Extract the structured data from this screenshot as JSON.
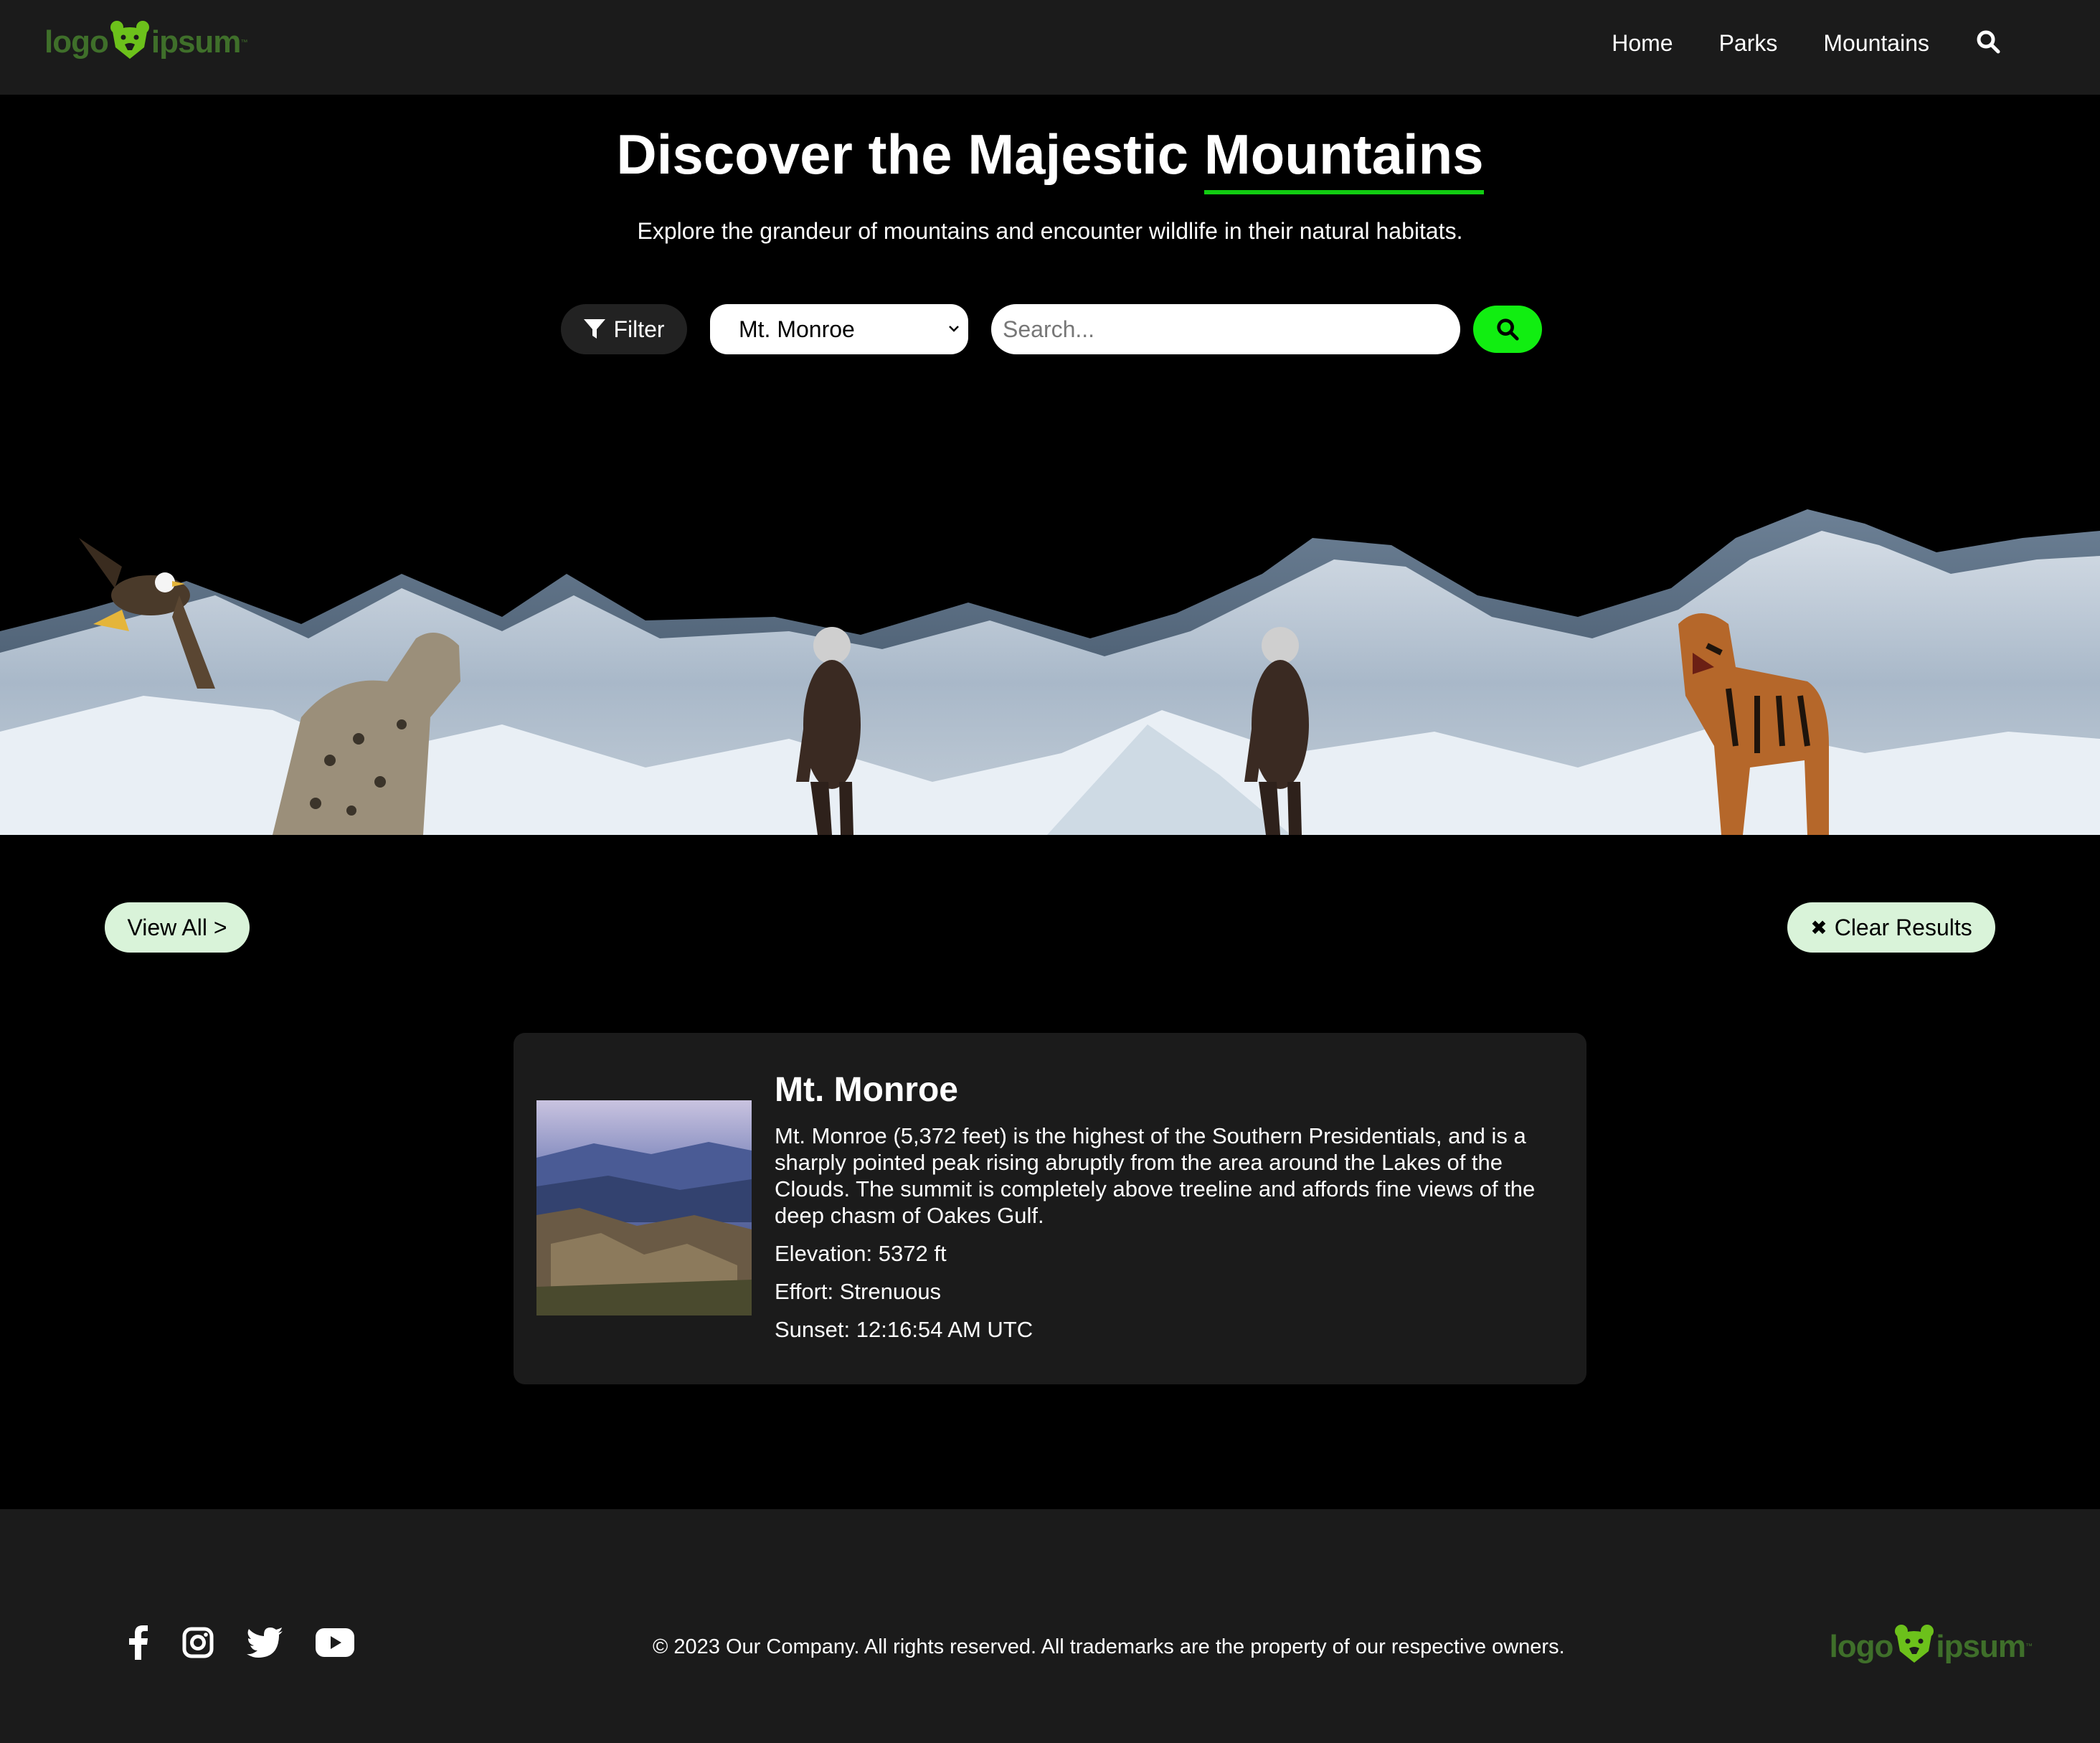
{
  "brand": {
    "logo_left": "logo",
    "logo_right": "ipsum",
    "logo_tm": "™",
    "color": "#3f6f2a",
    "icon_color": "#6cc11b"
  },
  "nav": {
    "links": [
      "Home",
      "Parks",
      "Mountains"
    ],
    "search_icon": "search-icon"
  },
  "hero": {
    "title_prefix": "Discover the Majestic",
    "title_highlight": "Mountains",
    "subtitle": "Explore the grandeur of mountains and encounter wildlife in their natural habitats.",
    "accent": "#11cc11"
  },
  "controls": {
    "filter_label": "Filter",
    "select_value": "Mt. Monroe",
    "search_placeholder": "Search...",
    "search_button_color": "#11ee11"
  },
  "actions": {
    "view_all": "View All >",
    "clear_results": "Clear Results",
    "clear_icon": "✖"
  },
  "result": {
    "name": "Mt. Monroe",
    "description": "Mt. Monroe (5,372 feet) is the highest of the Southern Presidentials, and is a sharply pointed peak rising abruptly from the area around the Lakes of the Clouds. The summit is completely above treeline and affords fine views of the deep chasm of Oakes Gulf.",
    "elevation": "Elevation: 5372 ft",
    "effort": "Effort: Strenuous",
    "sunset": "Sunset: 12:16:54 AM UTC"
  },
  "footer": {
    "socials": [
      "facebook-icon",
      "instagram-icon",
      "twitter-icon",
      "youtube-icon"
    ],
    "copyright": "© 2023 Our Company. All rights reserved. All trademarks are the property of our respective owners."
  }
}
